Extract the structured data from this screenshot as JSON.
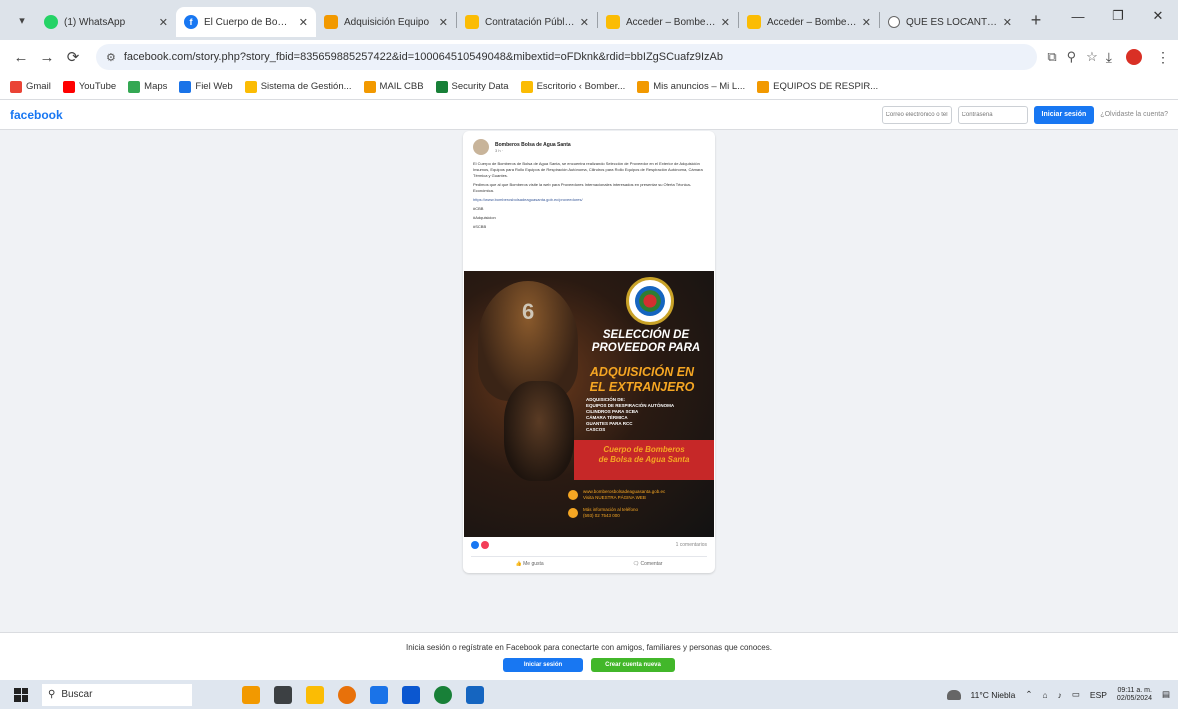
{
  "browser": {
    "tabs": [
      {
        "title": "(1) WhatsApp",
        "favicon": "whatsapp-icon",
        "active": false
      },
      {
        "title": "El Cuerpo de Bombero",
        "favicon": "facebook-icon",
        "active": true
      },
      {
        "title": "Adquisición Equipo",
        "favicon": "doc-icon",
        "active": false
      },
      {
        "title": "Contratación Pública",
        "favicon": "doc-icon",
        "active": false
      },
      {
        "title": "Acceder – Bomberos",
        "favicon": "doc-icon",
        "active": false
      },
      {
        "title": "Acceder – Bomberos",
        "favicon": "doc-icon",
        "active": false
      },
      {
        "title": "QUE ES LOCANTO - S",
        "favicon": "search-icon",
        "active": false
      }
    ],
    "url": "facebook.com/story.php?story_fbid=835659885257422&id=100064510549048&mibextid=oFDknk&rdid=bbIZgSCuafz9IzAb",
    "bookmarks": [
      {
        "label": "Gmail",
        "color": "#ea4335"
      },
      {
        "label": "YouTube",
        "color": "#ff0000"
      },
      {
        "label": "Maps",
        "color": "#34a853"
      },
      {
        "label": "Fiel Web",
        "color": "#1a73e8"
      },
      {
        "label": "Sistema de Gestión...",
        "color": "#fbbc04"
      },
      {
        "label": "MAIL CBB",
        "color": "#f29900"
      },
      {
        "label": "Security Data",
        "color": "#188038"
      },
      {
        "label": "Escritorio ‹ Bomber...",
        "color": "#fbbc04"
      },
      {
        "label": "Mis anuncios – Mi L...",
        "color": "#f29900"
      },
      {
        "label": "EQUIPOS DE RESPIR...",
        "color": "#f29900"
      }
    ]
  },
  "facebook": {
    "logo": "facebook",
    "email_placeholder": "Correo electrónico o tel.",
    "password_placeholder": "Contraseña",
    "login_button": "Iniciar sesión",
    "forgot": "¿Olvidaste la cuenta?"
  },
  "post": {
    "page_name": "Bomberos Bolsa de Agua Santa",
    "date": "3 h · ",
    "paragraphs": [
      "El Cuerpo de Bomberos de Bolsa de Agua Santa, se encuentra realizando Selección de Proveedor en el Exterior de Adquisición Insumos, Equipos para Rollo Equipos de Respiración Autónoma, Cilindros para Rollo Equipos de Respiración Autónoma, Cámara Térmica y Guantes.",
      "Pedimos que al que Bomberos visite la web para Proveedores Internacionales interesados en presentar su Oferta Técnica-Económica.",
      "https://www.bomberosbolsadeaguasanta.gob.ec/proveedores/"
    ],
    "link": "https://www.bomberosbolsadeaguasanta.gob.ec/proveedores/",
    "hashtags": [
      "#CBB",
      "#Adquisicion",
      "#SCBB"
    ],
    "reactions_count": "",
    "comments_shares": "1 comentarios",
    "actions": [
      "Me gusta",
      "Comentar"
    ]
  },
  "poster": {
    "helmet_number": "6",
    "title_line1": "SELECCIÓN DE",
    "title_line2": "PROVEEDOR PARA",
    "accent_line1": "ADQUISICIÓN EN",
    "accent_line2": "EL EXTRANJERO",
    "items": [
      "ADQUISICIÓN DE:",
      "EQUIPOS DE RESPIRACIÓN AUTÓNOMA",
      "CILINDROS PARA SCBA",
      "CÁMARA TÉRMICA",
      "GUANTES PARA RCC",
      "CASCOS"
    ],
    "band_line1": "Cuerpo de Bomberos",
    "band_line2": "de Bolsa de Agua Santa",
    "contact_web_label": "Visita NUESTRA PÁGINA WEB",
    "contact_web_url": "www.bomberosbolsadeaguasanta.gob.ec",
    "contact_phone_label": "Más información al teléfono",
    "contact_phone": "(593) 02 7543 000",
    "colors": {
      "accent": "#f5a623",
      "band": "#c62828"
    }
  },
  "banner": {
    "text": "Inicia sesión o regístrate en Facebook para conectarte con amigos, familiares y personas que conoces.",
    "login": "Iniciar sesión",
    "signup": "Crear cuenta nueva"
  },
  "taskbar": {
    "search": "Buscar",
    "weather": "11°C Niebla",
    "time": "09:11 a. m.",
    "date": "02/05/2024",
    "lang": "ESP"
  }
}
